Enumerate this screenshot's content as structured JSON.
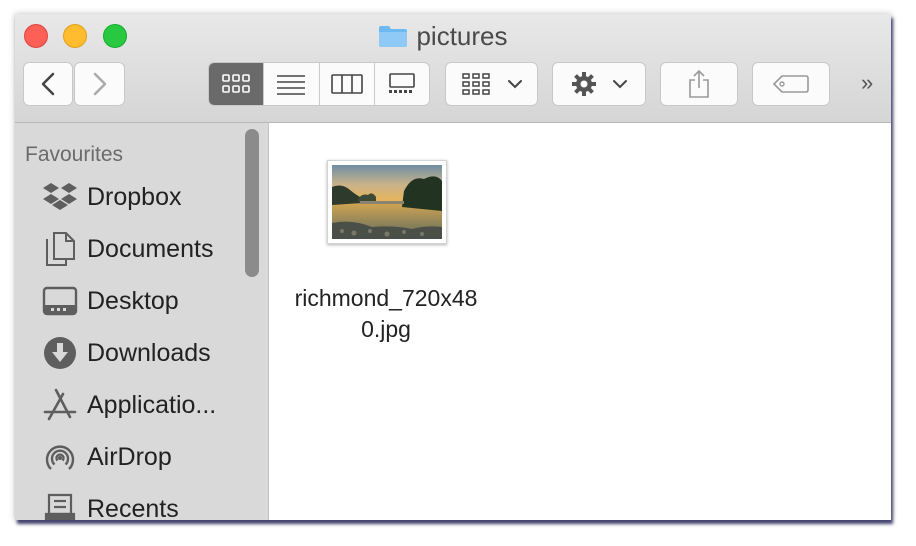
{
  "window": {
    "title": "pictures",
    "folder_icon": "folder-icon"
  },
  "toolbar": {
    "back_icon": "chevron-left-icon",
    "forward_icon": "chevron-right-icon",
    "view_modes": [
      "icon-view",
      "list-view",
      "column-view",
      "gallery-view"
    ],
    "active_view": "icon-view",
    "group_icon": "group-grid-icon",
    "action_icon": "gear-icon",
    "share_icon": "share-icon",
    "tag_icon": "tag-icon",
    "overflow": "»"
  },
  "sidebar": {
    "heading": "Favourites",
    "items": [
      {
        "label": "Dropbox",
        "icon": "dropbox-icon"
      },
      {
        "label": "Documents",
        "icon": "documents-icon"
      },
      {
        "label": "Desktop",
        "icon": "desktop-icon"
      },
      {
        "label": "Downloads",
        "icon": "downloads-icon"
      },
      {
        "label": "Applicatio...",
        "icon": "applications-icon"
      },
      {
        "label": "AirDrop",
        "icon": "airdrop-icon"
      },
      {
        "label": "Recents",
        "icon": "recents-icon"
      }
    ]
  },
  "content": {
    "files": [
      {
        "name_line1": "richmond_720x48",
        "name_line2": "0.jpg"
      }
    ]
  },
  "colors": {
    "close": "#fe5f57",
    "minimize": "#febc2e",
    "maximize": "#28c840",
    "folder": "#6eb9f2",
    "sidebar_bg": "#d9d9d9"
  }
}
